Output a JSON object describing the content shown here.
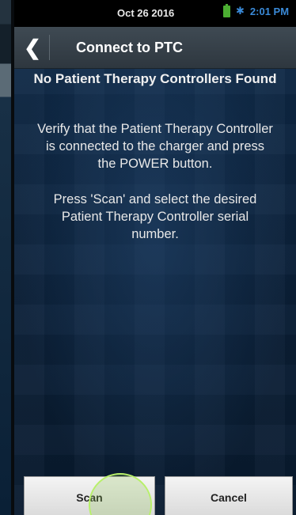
{
  "status_bar": {
    "date": "Oct 26 2016",
    "time": "2:01 PM",
    "battery_icon": "battery-charging-icon",
    "bluetooth_icon": "bluetooth-icon"
  },
  "title_bar": {
    "back_icon": "chevron-left-icon",
    "title": "Connect to PTC"
  },
  "content": {
    "heading": "No Patient Therapy Controllers Found",
    "message_1": "Verify that the Patient Therapy Controller\nis connected to the charger and press\nthe POWER button.",
    "message_2": "Press 'Scan' and select the desired\nPatient Therapy Controller serial\nnumber."
  },
  "buttons": {
    "scan_label": "Scan",
    "cancel_label": "Cancel"
  },
  "colors": {
    "title_bar": "#3a444c",
    "background": "#0f2b4a",
    "status_accent": "#3a8ad8",
    "battery": "#4cae32",
    "touch_indicator": "#b8f06a"
  }
}
